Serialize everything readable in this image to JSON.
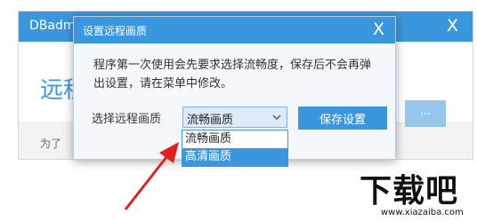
{
  "background_window": {
    "title": "DBadmi",
    "close_glyph": "X",
    "heading": "远程",
    "more_button": "...",
    "footer": "为了"
  },
  "dialog": {
    "title": "设置远程画质",
    "close_glyph": "X",
    "description": "程序第一次使用会先要求选择流畅度，保存后不会再弹出设置，请在菜单中修改。",
    "select_label": "选择远程画质",
    "select_value": "流畅画质",
    "save_button": "保存设置"
  },
  "dropdown": {
    "options": [
      "流畅画质",
      "高清画质"
    ],
    "highlighted_index": 1
  },
  "watermark": {
    "logo_text": "下载吧",
    "url": "www.xiazaiba.com"
  },
  "colors": {
    "accent": "#3b97dd",
    "arrow": "#e02020"
  }
}
